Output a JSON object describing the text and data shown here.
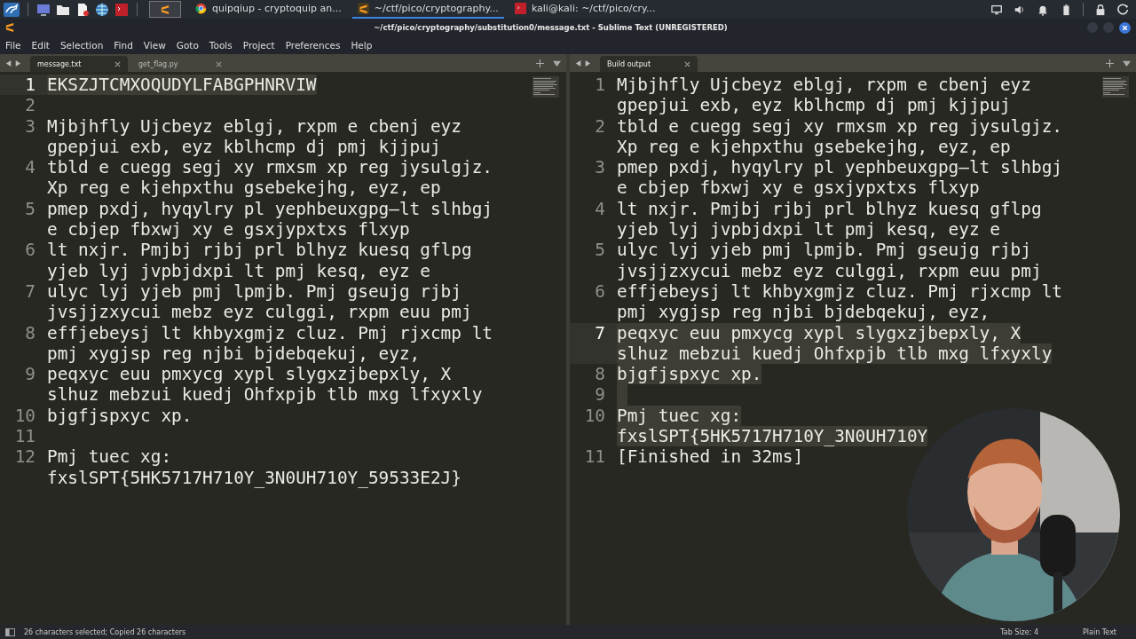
{
  "taskbar": {
    "launcher": {
      "selected": true
    },
    "tasks": [
      {
        "kind": "browser",
        "label": "quipqiup - cryptoquip an...",
        "selected": false
      },
      {
        "kind": "editor",
        "label": "~/ctf/pico/cryptography...",
        "selected": true
      },
      {
        "kind": "terminal",
        "label": "kali@kali: ~/ctf/pico/cry...",
        "selected": false
      }
    ]
  },
  "window": {
    "title": "~/ctf/pico/cryptography/substitution0/message.txt - Sublime Text (UNREGISTERED)"
  },
  "menu": [
    "File",
    "Edit",
    "Selection",
    "Find",
    "View",
    "Goto",
    "Tools",
    "Project",
    "Preferences",
    "Help"
  ],
  "panes": [
    {
      "tabs": [
        {
          "label": "message.txt",
          "selected": true
        },
        {
          "label": "get_flag.py",
          "selected": false
        }
      ],
      "lines": [
        {
          "number": "1",
          "rows": [
            "EKSZJTCMXOQUDYLFABGPHNRVIW"
          ],
          "selected": true,
          "current": true
        },
        {
          "number": "2",
          "selected": false,
          "current": false
        },
        {
          "number": "3",
          "rows": [
            "Mjbjhfly Ujcbeyz eblgj, rxpm e cbenj eyz",
            "gpepjui exb, eyz kblhcmp dj pmj kjjpuj"
          ],
          "selected": false,
          "current": false
        },
        {
          "number": "4",
          "rows": [
            "tbld e cuegg segj xy rmxsm xp reg jysulgjz.",
            "Xp reg e kjehpxthu gsebekejhg, eyz, ep"
          ],
          "selected": false,
          "current": false
        },
        {
          "number": "5",
          "rows": [
            "pmep pxdj, hyqylry pl yephbeuxgpg—lt slhbgj",
            "e cbjep fbxwj xy e gsxjypxtxs flxyp"
          ],
          "selected": false,
          "current": false
        },
        {
          "number": "6",
          "rows": [
            "lt nxjr. Pmjbj rjbj prl blhyz kuesq gflpg",
            "yjeb lyj jvpbjdxpi lt pmj kesq, eyz e"
          ],
          "selected": false,
          "current": false
        },
        {
          "number": "7",
          "rows": [
            "ulyc lyj yjeb pmj lpmjb. Pmj gseujg rjbj",
            "jvsjjzxycui mebz eyz culggi, rxpm euu pmj"
          ],
          "selected": false,
          "current": false
        },
        {
          "number": "8",
          "rows": [
            "effjebeysj lt khbyxgmjz cluz. Pmj rjxcmp lt",
            "pmj xygjsp reg njbi bjdebqekuj, eyz,"
          ],
          "selected": false,
          "current": false
        },
        {
          "number": "9",
          "rows": [
            "peqxyc euu pmxycg xypl slygxzjbepxly, X",
            "slhuz mebzui kuedj Ohfxpjb tlb mxg lfxyxly"
          ],
          "selected": false,
          "current": false
        },
        {
          "number": "10",
          "rows": [
            "bjgfjspxyc xp."
          ],
          "selected": false,
          "current": false
        },
        {
          "number": "11",
          "selected": false,
          "current": false
        },
        {
          "number": "12",
          "rows": [
            "Pmj tuec xg:",
            "fxslSPT{5HK5717H710Y_3N0UH710Y_59533E2J}"
          ],
          "selected": false,
          "current": false
        }
      ]
    },
    {
      "tabs": [
        {
          "label": "Build output",
          "selected": true
        }
      ],
      "lines": [
        {
          "number": "1",
          "rows": [
            "Mjbjhfly Ujcbeyz eblgj, rxpm e cbenj eyz",
            "gpepjui exb, eyz kblhcmp dj pmj kjjpuj"
          ],
          "selected": false,
          "current": false
        },
        {
          "number": "2",
          "rows": [
            "tbld e cuegg segj xy rmxsm xp reg jysulgjz.",
            "Xp reg e kjehpxthu gsebekejhg, eyz, ep"
          ],
          "selected": false,
          "current": false
        },
        {
          "number": "3",
          "rows": [
            "pmep pxdj, hyqylry pl yephbeuxgpg—lt slhbgj",
            "e cbjep fbxwj xy e gsxjypxtxs flxyp"
          ],
          "selected": false,
          "current": false
        },
        {
          "number": "4",
          "rows": [
            "lt nxjr. Pmjbj rjbj prl blhyz kuesq gflpg",
            "yjeb lyj jvpbjdxpi lt pmj kesq, eyz e"
          ],
          "selected": false,
          "current": false
        },
        {
          "number": "5",
          "rows": [
            "ulyc lyj yjeb pmj lpmjb. Pmj gseujg rjbj",
            "jvsjjzxycui mebz eyz culggi, rxpm euu pmj"
          ],
          "selected": false,
          "current": false
        },
        {
          "number": "6",
          "rows": [
            "effjebeysj lt khbyxgmjz cluz. Pmj rjxcmp lt",
            "pmj xygjsp reg njbi bjdebqekuj, eyz,"
          ],
          "selected": false,
          "current": false
        },
        {
          "number": "7",
          "rows": [
            "peqxyc euu pmxycg xypl slygxzjbepxly, X",
            "slhuz mebzui kuedj Ohfxpjb tlb mxg lfxyxly"
          ],
          "selected": true,
          "current": true
        },
        {
          "number": "8",
          "rows": [
            "bjgfjspxyc xp."
          ],
          "selected": true,
          "current": false
        },
        {
          "number": "9",
          "selected": true,
          "current": false
        },
        {
          "number": "10",
          "rows": [
            "Pmj tuec xg:",
            "fxslSPT{5HK5717H710Y_3N0UH710Y"
          ],
          "selected": true,
          "current": false
        },
        {
          "number": "11",
          "rows": [
            "[Finished in 32ms]"
          ],
          "selected": false,
          "current": false
        }
      ]
    }
  ],
  "webcam": {
    "kind": "picture"
  },
  "status_bar": {
    "message": "26 characters selected; Copied 26 characters",
    "tab_size": "Tab Size: 4",
    "syntax": "Plain Text"
  }
}
